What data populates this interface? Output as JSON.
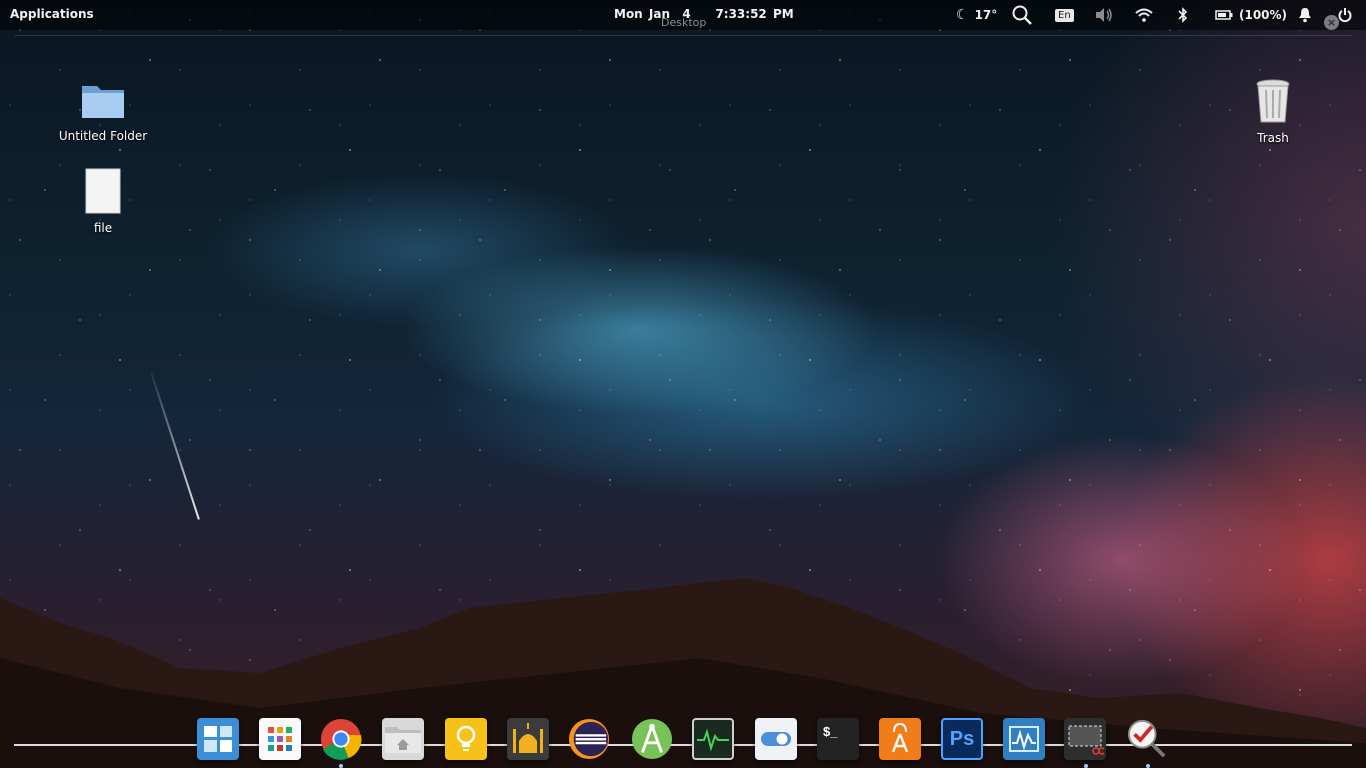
{
  "panel": {
    "applications_label": "Applications",
    "clock": "Mon Jan  4    7:33:52 PM",
    "workspace_label": "Desktop",
    "weather_temp": "17°",
    "keyboard_layout": "En",
    "battery_label": "(100%)"
  },
  "desktop": {
    "icons": [
      {
        "label": "Untitled Folder",
        "icon": "folder-icon"
      },
      {
        "label": "file",
        "icon": "file-icon"
      },
      {
        "label": "Trash",
        "icon": "trash-icon"
      }
    ]
  },
  "dock": {
    "items": [
      {
        "name": "multitasking-view",
        "icon": "windows-grid-icon",
        "color": "#4aa3e0"
      },
      {
        "name": "app-grid",
        "icon": "app-grid-icon",
        "color": "#ffffff"
      },
      {
        "name": "google-chrome",
        "icon": "chrome-icon",
        "color": "#db4437"
      },
      {
        "name": "files",
        "icon": "home-folder-icon",
        "color": "#dcdcdc"
      },
      {
        "name": "ideas",
        "icon": "lightbulb-icon",
        "color": "#f6c21a"
      },
      {
        "name": "mosque-app",
        "icon": "mosque-icon",
        "color": "#f2b01e"
      },
      {
        "name": "eclipse",
        "icon": "eclipse-icon",
        "color": "#2c2255"
      },
      {
        "name": "android-studio",
        "icon": "android-studio-icon",
        "color": "#78c257"
      },
      {
        "name": "system-monitor",
        "icon": "system-monitor-icon",
        "color": "#1b2a1f"
      },
      {
        "name": "switchboard",
        "icon": "toggle-icon",
        "color": "#e8eef4"
      },
      {
        "name": "terminal",
        "icon": "terminal-icon",
        "color": "#222222"
      },
      {
        "name": "appcenter",
        "icon": "shopping-bag-icon",
        "color": "#f07d1a"
      },
      {
        "name": "photoshop",
        "icon": "photoshop-icon",
        "color": "#0a2a5c"
      },
      {
        "name": "monitor-app",
        "icon": "waveform-icon",
        "color": "#2f7fc2"
      },
      {
        "name": "screenshot",
        "icon": "screenshot-icon",
        "color": "#333333"
      },
      {
        "name": "search-tool",
        "icon": "magnifier-check-icon",
        "color": "#cc2a2a"
      }
    ],
    "terminal_glyph": "$_",
    "photoshop_glyph": "Ps"
  }
}
